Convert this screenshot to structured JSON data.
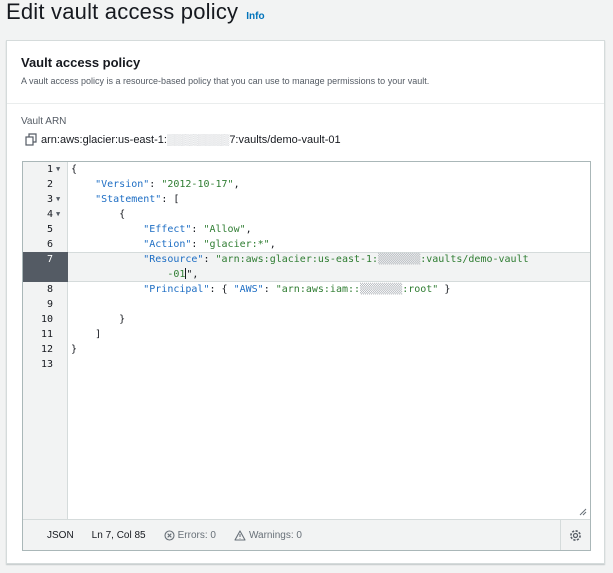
{
  "page": {
    "title": "Edit vault access policy",
    "info_link": "Info"
  },
  "panel": {
    "title": "Vault access policy",
    "description": "A vault access policy is a resource-based policy that you can use to manage permissions to your vault."
  },
  "vault_arn": {
    "label": "Vault ARN",
    "prefix": "arn:aws:glacier:us-east-1:",
    "suffix": "7:vaults/demo-vault-01"
  },
  "editor": {
    "line_numbers": [
      "1",
      "2",
      "3",
      "4",
      "5",
      "6",
      "7",
      "8",
      "9",
      "10",
      "11",
      "12",
      "13"
    ],
    "code": {
      "line1": "{",
      "line2_key": "\"Version\"",
      "line2_val": "\"2012-10-17\"",
      "line3_key": "\"Statement\"",
      "line3_rest": ": [",
      "line4": "{",
      "line5_key": "\"Effect\"",
      "line5_val": "\"Allow\"",
      "line6_key": "\"Action\"",
      "line6_val": "\"glacier:*\"",
      "line7_key": "\"Resource\"",
      "line7_val_a": "\"arn:aws:glacier:us-east-1:",
      "line7_val_b": ":vaults/demo-vault",
      "line7_wrap_a": "-01",
      "line7_wrap_b": "\",",
      "line8_key": "\"Principal\"",
      "line8_key2": "\"AWS\"",
      "line8_val_a": "\"arn:aws:iam::",
      "line8_val_b": ":root\"",
      "line10": "}",
      "line11": "]",
      "line12": "}"
    },
    "status": {
      "mode": "JSON",
      "position": "Ln 7, Col 85",
      "errors": "Errors: 0",
      "warnings": "Warnings: 0"
    }
  },
  "colors": {
    "accent": "#0073bb",
    "key": "#1e6ec4",
    "string": "#2f7d32",
    "gutter_active": "#545b64"
  }
}
